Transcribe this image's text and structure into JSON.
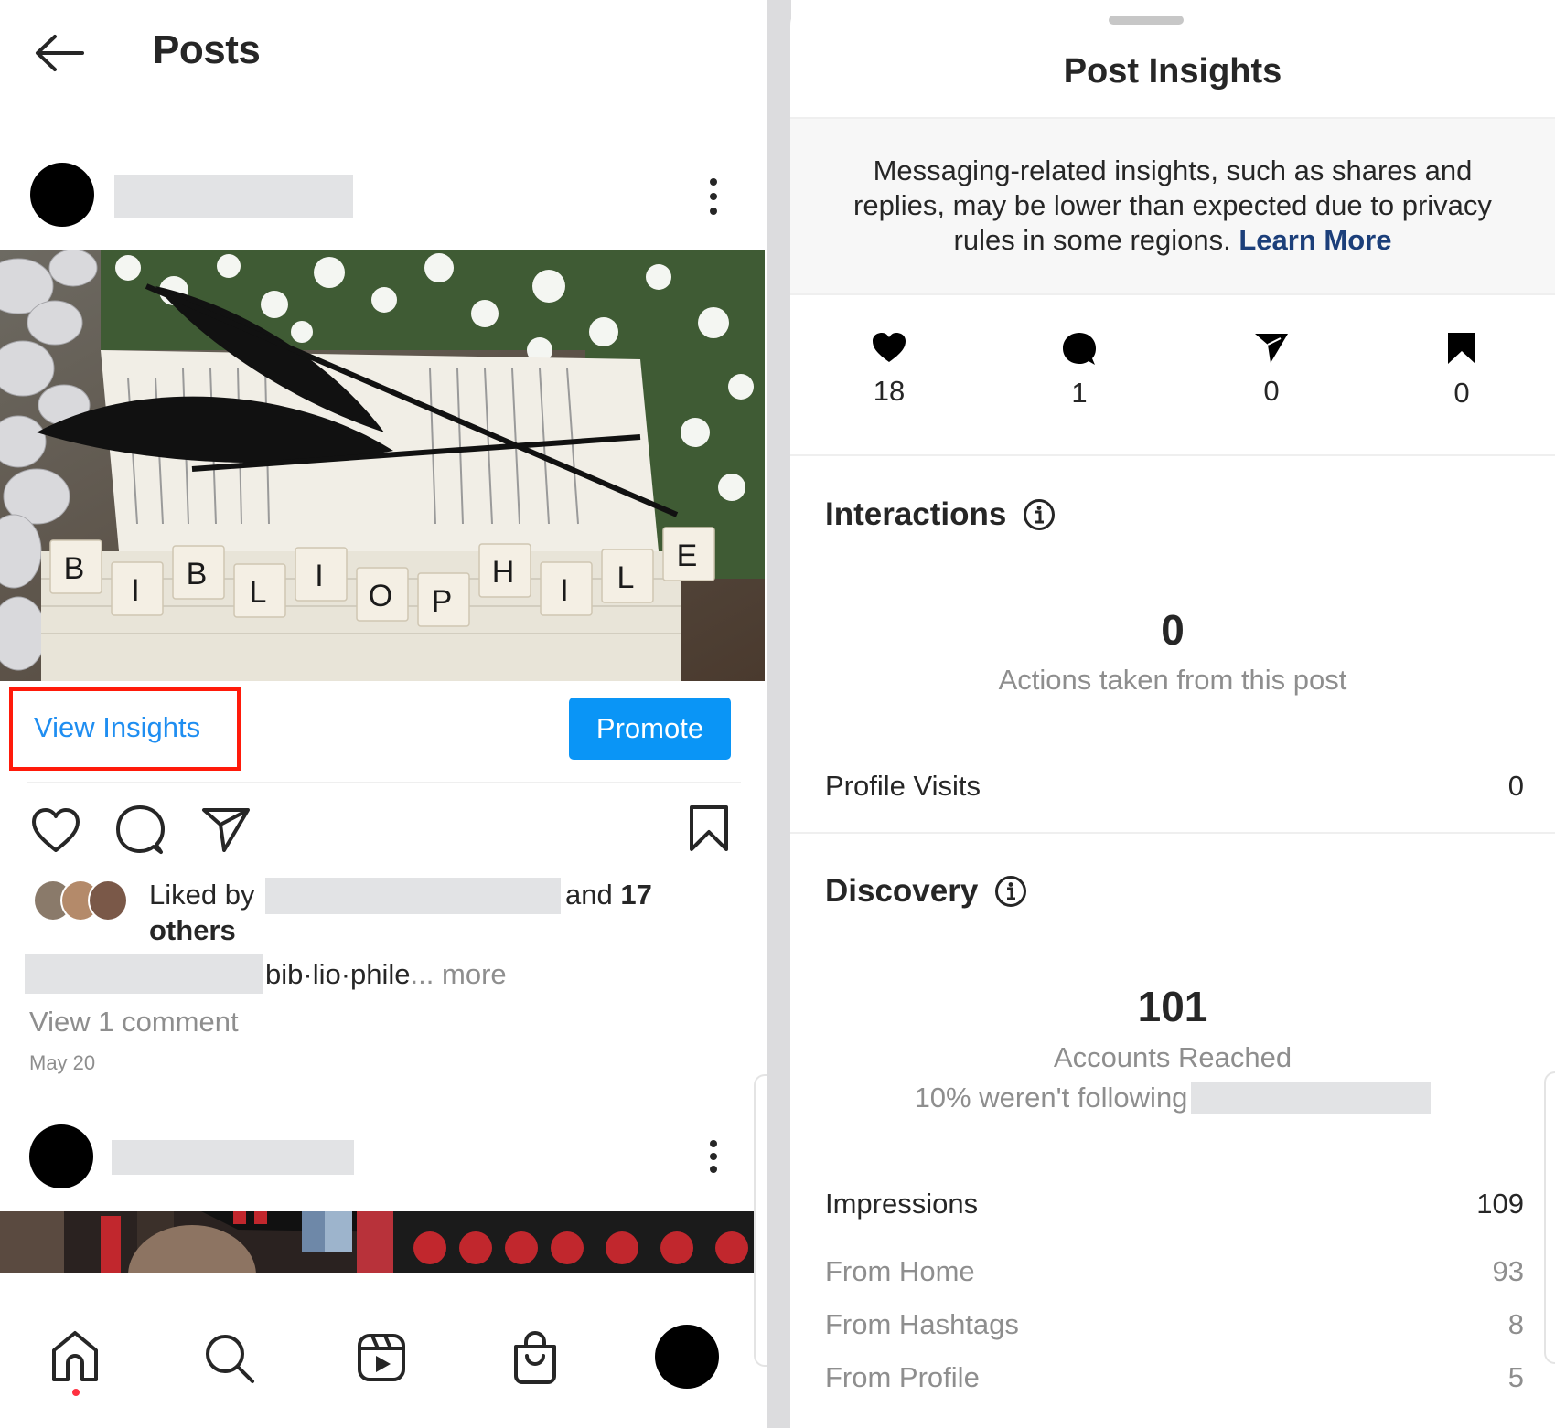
{
  "posts_screen": {
    "title": "Posts",
    "back_icon": "arrow-left-icon",
    "post": {
      "username_redacted": true,
      "more_icon": "more-vertical-icon",
      "photo_description": "Open book with black feathers, white flowers, and scrabble tiles spelling BIBLIOPHILE",
      "tiles": [
        "B",
        "I",
        "B",
        "L",
        "I",
        "O",
        "P",
        "H",
        "I",
        "L",
        "E"
      ],
      "view_insights_label": "View Insights",
      "promote_label": "Promote",
      "liked_by_prefix": "Liked by",
      "liked_by_and": "and",
      "liked_by_count": "17",
      "liked_by_others": "others",
      "caption_text": "bib·lio·phile",
      "caption_ellipsis": "...",
      "caption_more": "more",
      "view_comments": "View 1 comment",
      "date": "May 20"
    },
    "highlight_color": "#ff1a0a",
    "accent_color": "#0a95f6",
    "bottom_nav": [
      "home-icon",
      "search-icon",
      "reels-icon",
      "shop-icon",
      "profile-avatar"
    ]
  },
  "insights_sheet": {
    "title": "Post Insights",
    "banner_text": "Messaging-related insights, such as shares and replies, may be lower than expected due to privacy rules in some regions.",
    "banner_link": "Learn More",
    "stats": [
      {
        "icon": "heart-icon",
        "value": "18"
      },
      {
        "icon": "comment-icon",
        "value": "1"
      },
      {
        "icon": "share-icon",
        "value": "0"
      },
      {
        "icon": "bookmark-icon",
        "value": "0"
      }
    ],
    "interactions": {
      "title": "Interactions",
      "value": "0",
      "subtitle": "Actions taken from this post",
      "rows": [
        {
          "label": "Profile Visits",
          "value": "0"
        }
      ]
    },
    "discovery": {
      "title": "Discovery",
      "value": "101",
      "subtitle": "Accounts Reached",
      "following_note": "10% weren't following",
      "impressions_label": "Impressions",
      "impressions_value": "109",
      "breakdown": [
        {
          "label": "From Home",
          "value": "93"
        },
        {
          "label": "From Hashtags",
          "value": "8"
        },
        {
          "label": "From Profile",
          "value": "5"
        }
      ]
    }
  }
}
